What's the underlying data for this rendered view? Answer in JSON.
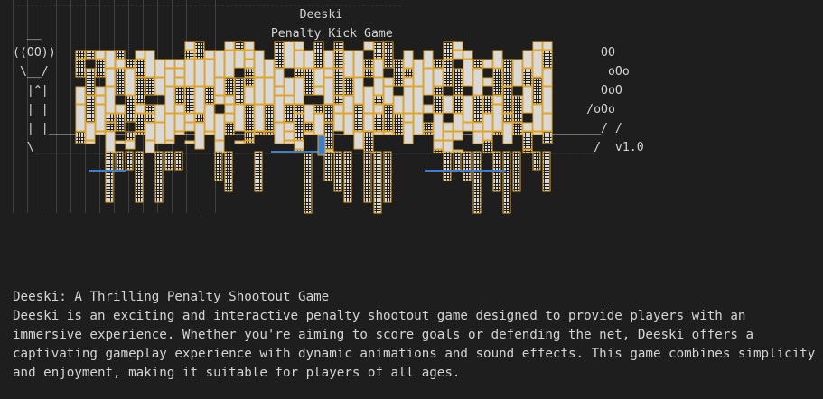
{
  "editor": {
    "ascii_title": "Deeski",
    "ascii_subtitle": "Penalty Kick Game",
    "ascii_lines": [
      "                                        Deeski",
      "  __                                Penalty Kick Game",
      "((OO))                                                                            OO",
      " \\__/                                                                              oOo",
      "  |^|                                                                             OoO",
      "  | |                                                                           /oOo",
      "  | |_____________________________________________________________________________/ /",
      "  \\______________________________________________________________________________/  v1.0"
    ],
    "version": "v1.0",
    "description_heading": "Deeski: A Thrilling Penalty Shootout Game",
    "description_lines": [
      "Deeski is an exciting and interactive penalty shootout game designed to provide players with an",
      "immersive experience. Whether you're aiming to score goals or defending the net, Deeski offers a",
      "captivating gameplay experience with dynamic animations and sound effects. This game combines simplicity",
      "and enjoyment, making it suitable for players of all ages."
    ]
  },
  "colors": {
    "background": "#1e1e1e",
    "text": "#d4d4d4",
    "decoration_border": "#e0a526",
    "decoration_fill": "#d9d9d9",
    "decoration_blue": "#3a7fd5",
    "indent_guide": "#404040"
  }
}
